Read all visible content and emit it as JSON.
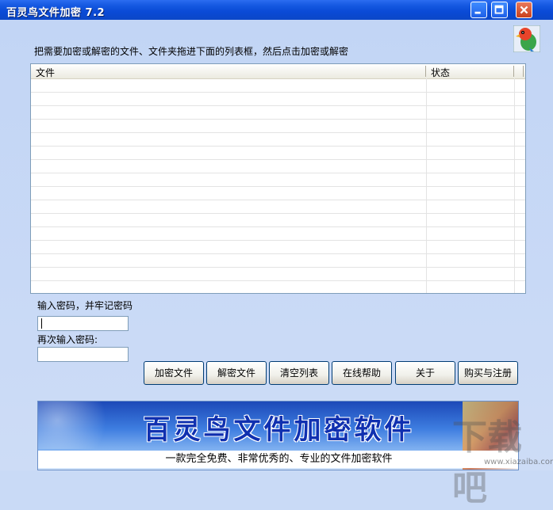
{
  "window": {
    "title": "百灵鸟文件加密 7.2"
  },
  "instruction": "把需要加密或解密的文件、文件夹拖进下面的列表框，然后点击加密或解密",
  "file_list": {
    "columns": [
      "文件",
      "状态"
    ],
    "rows": []
  },
  "password": {
    "label": "输入密码，并牢记密码",
    "value": ""
  },
  "confirm_password": {
    "label": "再次输入密码:",
    "value": ""
  },
  "buttons": {
    "encrypt": "加密文件",
    "decrypt": "解密文件",
    "clear": "清空列表",
    "help": "在线帮助",
    "about": "关于",
    "buy": "购买与注册"
  },
  "banner": {
    "title": "百灵鸟文件加密软件",
    "subtitle": "一款完全免费、非常优秀的、专业的文件加密软件"
  },
  "watermark": {
    "url": "www.xiazaiba.com"
  },
  "colors": {
    "titlebar": "#0a4ad6",
    "window_bg": "#c7d8f6",
    "button_border": "#003c74",
    "banner_title": "#1030b0"
  }
}
